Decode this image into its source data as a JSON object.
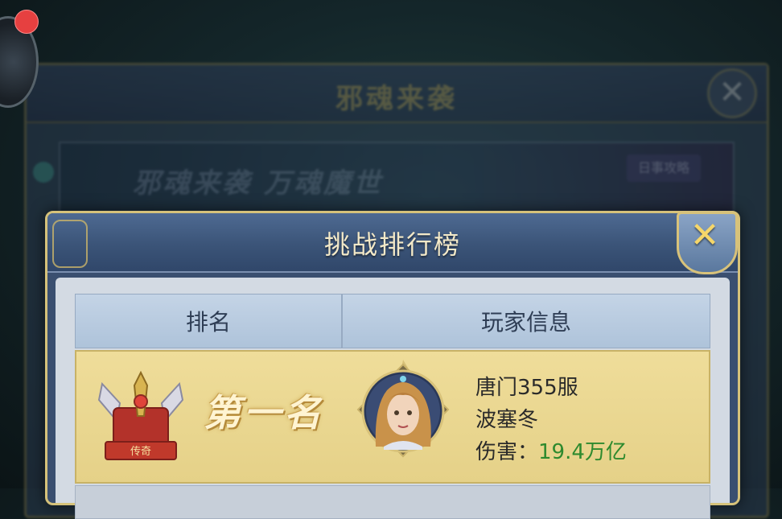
{
  "background_window": {
    "title": "邪魂来袭",
    "banner_text": "邪魂来袭 万魂魔世",
    "banner_button": "日事攻略"
  },
  "side_button": {
    "icon": "chevron-right-icon",
    "notification_dot": true
  },
  "leaderboard": {
    "title": "挑战排行榜",
    "close_icon": "close-icon",
    "columns": [
      "排名",
      "玩家信息"
    ],
    "rows": [
      {
        "rank_label": "第一名",
        "emblem_text": "传奇",
        "avatar_icon": "avatar",
        "server": "唐门355服",
        "player_name": "波塞冬",
        "damage_label": "伤害：",
        "damage_value": "19.4万亿"
      }
    ]
  },
  "colors": {
    "accent_gold": "#d6c27a",
    "damage_green": "#2e8a2e",
    "header_blue": "#3b5478",
    "row_gold": "#e5d188"
  }
}
